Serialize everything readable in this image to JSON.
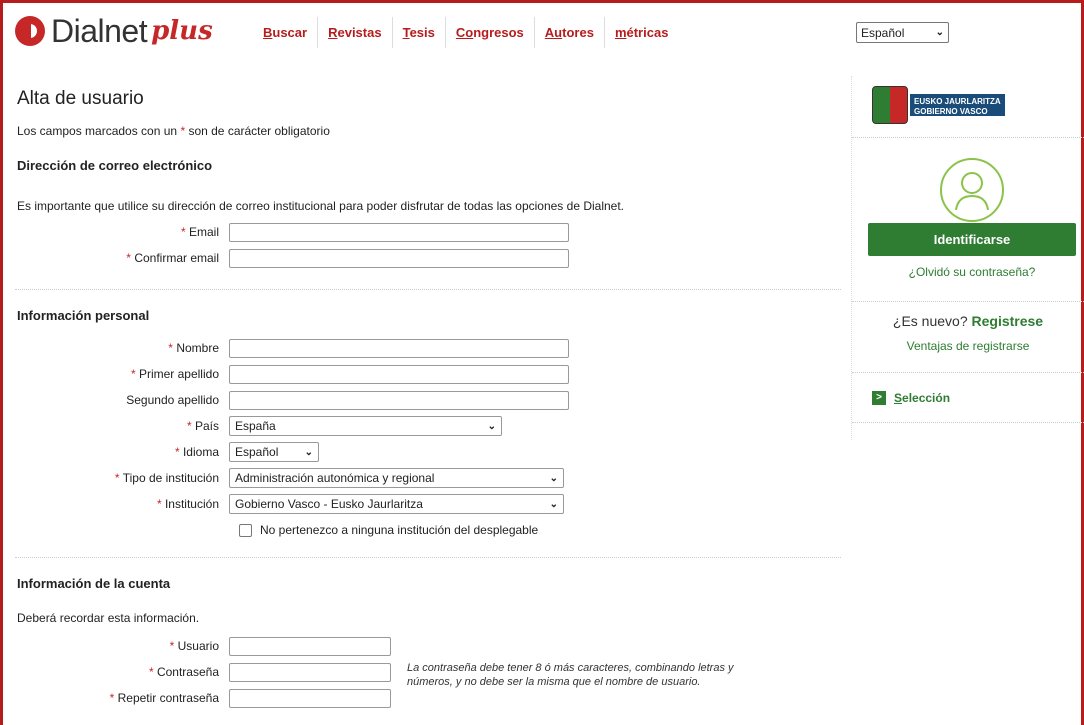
{
  "header": {
    "logo_text": "Dialnet",
    "logo_plus": "plus",
    "nav": [
      {
        "first": "B",
        "rest": "uscar"
      },
      {
        "first": "R",
        "rest": "evistas"
      },
      {
        "first": "T",
        "rest": "esis"
      },
      {
        "first": "Co",
        "rest": "ngresos"
      },
      {
        "first": "Au",
        "rest": "tores"
      },
      {
        "first": "m",
        "rest": "étricas"
      }
    ],
    "language": "Español"
  },
  "form": {
    "title": "Alta de usuario",
    "required_note_before": "Los campos marcados con un",
    "required_mark": "*",
    "required_note_after": "son de carácter obligatorio",
    "email_section": {
      "heading": "Dirección de correo electrónico",
      "info": "Es importante que utilice su dirección de correo institucional para poder disfrutar de todas las opciones de Dialnet.",
      "email_label": "Email",
      "email_value": "",
      "confirm_label": "Confirmar email",
      "confirm_value": ""
    },
    "personal_section": {
      "heading": "Información personal",
      "nombre_label": "Nombre",
      "apellido1_label": "Primer apellido",
      "apellido2_label": "Segundo apellido",
      "pais_label": "País",
      "pais_value": "España",
      "idioma_label": "Idioma",
      "idioma_value": "Español",
      "tipo_label": "Tipo de institución",
      "tipo_value": "Administración autonómica y regional",
      "institucion_label": "Institución",
      "institucion_value": "Gobierno Vasco - Eusko Jaurlaritza",
      "no_institucion_label": "No pertenezco a ninguna institución del desplegable"
    },
    "account_section": {
      "heading": "Información de la cuenta",
      "info": "Deberá recordar esta información.",
      "usuario_label": "Usuario",
      "password_label": "Contraseña",
      "repeat_password_label": "Repetir contraseña",
      "password_note": "La contraseña debe tener 8 ó más caracteres, combinando letras y números, y no debe ser la misma que el nombre de usuario."
    }
  },
  "sidebar": {
    "gv_line1": "EUSKO JAURLARITZA",
    "gv_line2": "GOBIERNO VASCO",
    "login_button": "Identificarse",
    "forgot_password": "¿Olvidó su contraseña?",
    "new_user_text": "¿Es nuevo?",
    "register_link": "Registrese",
    "advantages_link": "Ventajas de registrarse",
    "selection_icon": ">",
    "selection_first": "S",
    "selection_rest": "elección"
  },
  "colors": {
    "brand_red": "#c62828",
    "green": "#2e7d32"
  }
}
